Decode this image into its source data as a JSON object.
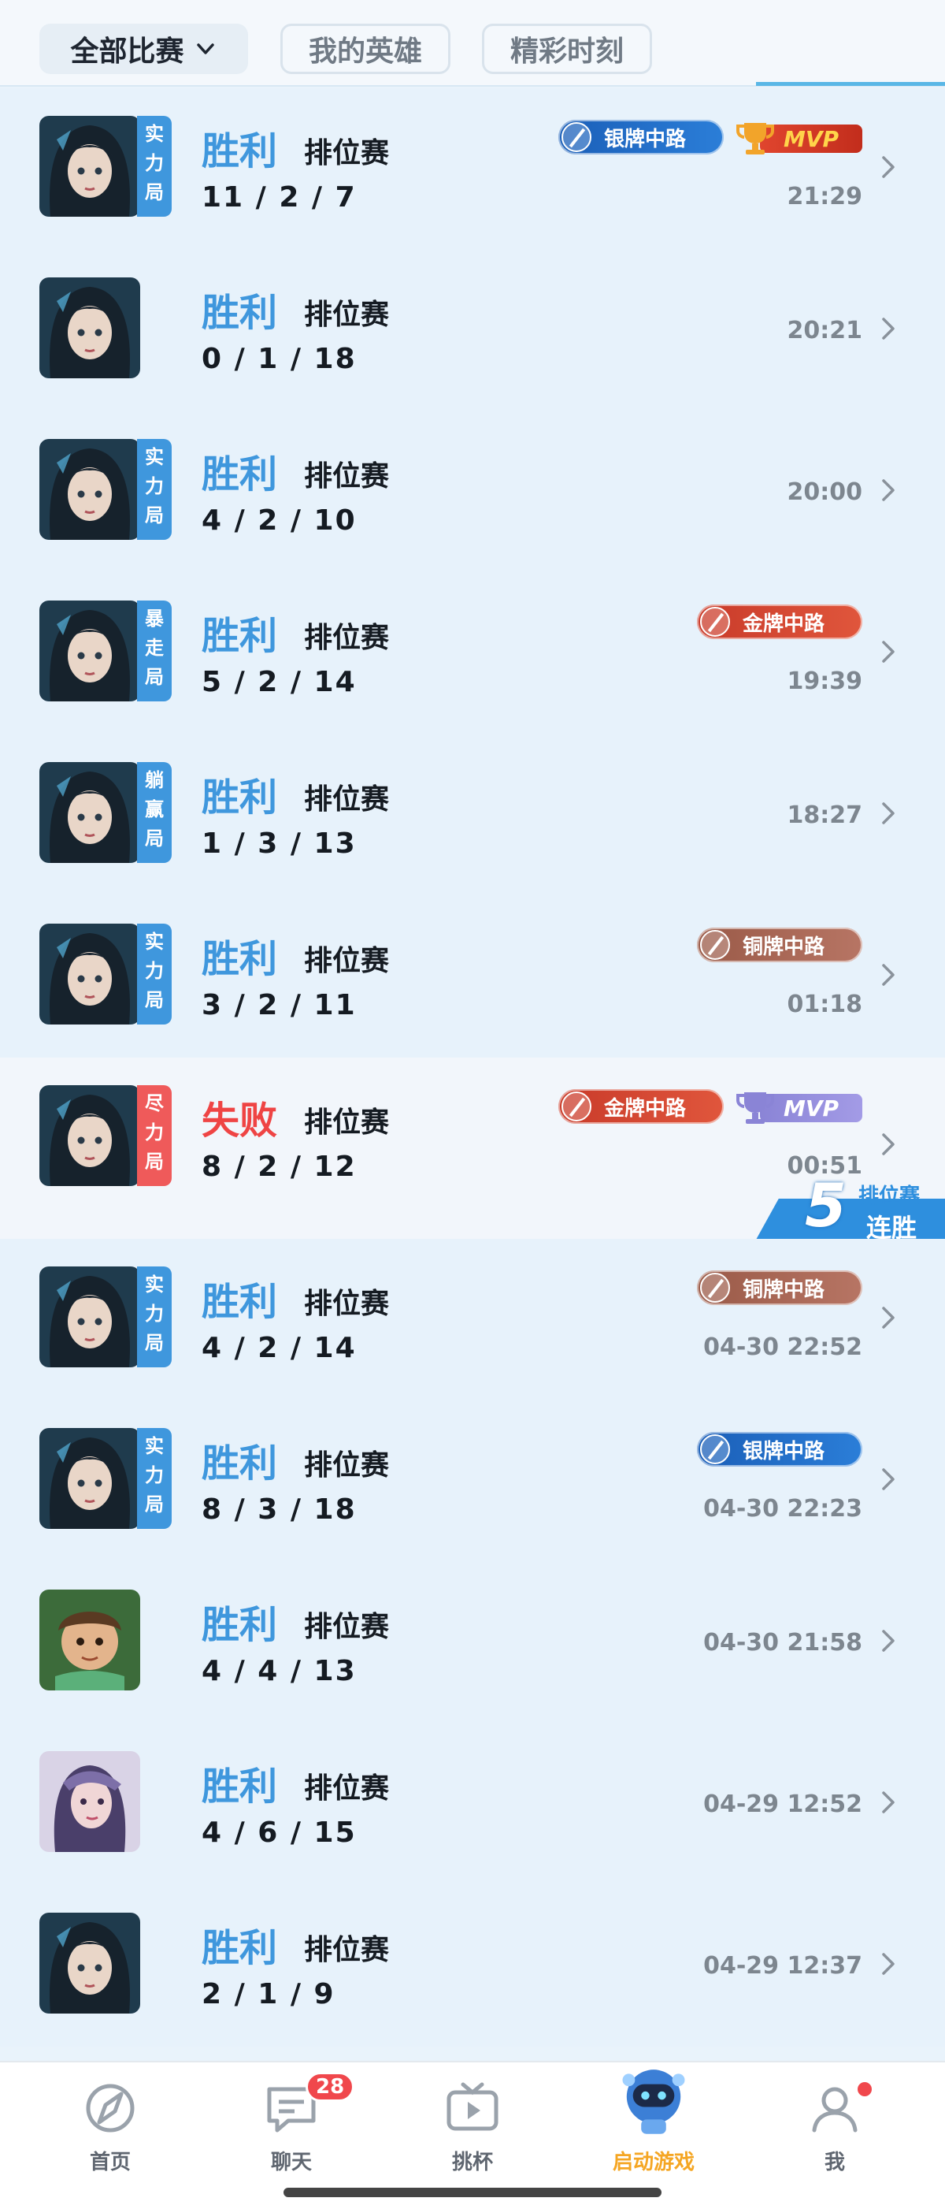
{
  "filters": {
    "all_label": "全部比赛",
    "hero_label": "我的英雄",
    "moment_label": "精彩时刻"
  },
  "colors": {
    "win": "#3f97dd",
    "loss": "#ef4444",
    "accent": "#f5a623"
  },
  "matches": [
    {
      "result": "胜利",
      "type": "排位赛",
      "kda": "11 / 2 / 7",
      "time": "21:29",
      "tag": [
        "实",
        "力",
        "局"
      ],
      "tag_color": "blue",
      "portrait": "hero-dark",
      "badge": "银牌中路",
      "badge_style": "silver",
      "mvp": "MVP",
      "mvp_style": "red"
    },
    {
      "result": "胜利",
      "type": "排位赛",
      "kda": "0 / 1 / 18",
      "time": "20:21",
      "tag": null,
      "portrait": "hero-dark"
    },
    {
      "result": "胜利",
      "type": "排位赛",
      "kda": "4 / 2 / 10",
      "time": "20:00",
      "tag": [
        "实",
        "力",
        "局"
      ],
      "tag_color": "blue",
      "portrait": "hero-dark"
    },
    {
      "result": "胜利",
      "type": "排位赛",
      "kda": "5 / 2 / 14",
      "time": "19:39",
      "tag": [
        "暴",
        "走",
        "局"
      ],
      "tag_color": "blue",
      "portrait": "hero-dark",
      "badge": "金牌中路",
      "badge_style": "gold"
    },
    {
      "result": "胜利",
      "type": "排位赛",
      "kda": "1 / 3 / 13",
      "time": "18:27",
      "tag": [
        "躺",
        "赢",
        "局"
      ],
      "tag_color": "blue",
      "portrait": "hero-dark"
    },
    {
      "result": "胜利",
      "type": "排位赛",
      "kda": "3 / 2 / 11",
      "time": "01:18",
      "tag": [
        "实",
        "力",
        "局"
      ],
      "tag_color": "blue",
      "portrait": "hero-dark",
      "badge": "铜牌中路",
      "badge_style": "bronze"
    },
    {
      "result": "失败",
      "type": "排位赛",
      "kda": "8 / 2 / 12",
      "time": "00:51",
      "tag": [
        "尽",
        "力",
        "局"
      ],
      "tag_color": "red",
      "portrait": "hero-dark",
      "badge": "金牌中路",
      "badge_style": "gold",
      "mvp": "MVP",
      "mvp_style": "purple",
      "loss": true,
      "streak": {
        "count": "5",
        "line1": "排位赛",
        "line2": "连胜"
      }
    },
    {
      "result": "胜利",
      "type": "排位赛",
      "kda": "4 / 2 / 14",
      "time": "04-30 22:52",
      "tag": [
        "实",
        "力",
        "局"
      ],
      "tag_color": "blue",
      "portrait": "hero-dark",
      "badge": "铜牌中路",
      "badge_style": "bronze"
    },
    {
      "result": "胜利",
      "type": "排位赛",
      "kda": "8 / 3 / 18",
      "time": "04-30 22:23",
      "tag": [
        "实",
        "力",
        "局"
      ],
      "tag_color": "blue",
      "portrait": "hero-dark",
      "badge": "银牌中路",
      "badge_style": "silver"
    },
    {
      "result": "胜利",
      "type": "排位赛",
      "kda": "4 / 4 / 13",
      "time": "04-30 21:58",
      "tag": null,
      "portrait": "hero-boy"
    },
    {
      "result": "胜利",
      "type": "排位赛",
      "kda": "4 / 6 / 15",
      "time": "04-29 12:52",
      "tag": null,
      "portrait": "hero-lady"
    },
    {
      "result": "胜利",
      "type": "排位赛",
      "kda": "2 / 1 / 9",
      "time": "04-29 12:37",
      "tag": null,
      "portrait": "hero-dark"
    }
  ],
  "nav": {
    "home": "首页",
    "chat": "聊天",
    "chat_badge": "28",
    "cup": "挑杯",
    "game": "启动游戏",
    "me": "我"
  }
}
